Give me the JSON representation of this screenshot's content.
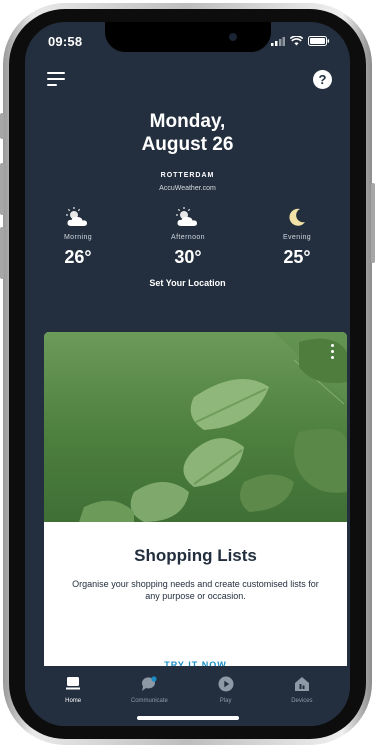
{
  "status_bar": {
    "time": "09:58"
  },
  "header": {
    "date_line1": "Monday,",
    "date_line2": "August 26"
  },
  "weather": {
    "city": "ROTTERDAM",
    "provider": "AccuWeather.com",
    "periods": [
      {
        "label": "Morning",
        "temp": "26°",
        "icon": "partly-sunny-icon"
      },
      {
        "label": "Afternoon",
        "temp": "30°",
        "icon": "partly-sunny-icon"
      },
      {
        "label": "Evening",
        "temp": "25°",
        "icon": "moon-icon"
      }
    ],
    "set_location": "Set Your Location"
  },
  "card": {
    "title": "Shopping Lists",
    "description": "Organise your shopping needs and create customised lists for any purpose or occasion.",
    "cta": "TRY IT NOW"
  },
  "tabs": [
    {
      "label": "Home",
      "icon": "home-icon",
      "active": true
    },
    {
      "label": "Communicate",
      "icon": "chat-icon",
      "active": false
    },
    {
      "label": "Play",
      "icon": "play-icon",
      "active": false
    },
    {
      "label": "Devices",
      "icon": "devices-icon",
      "active": false
    }
  ],
  "colors": {
    "background": "#232f3e",
    "accent": "#1a8cc8",
    "card_green": "#4d7f3f"
  }
}
